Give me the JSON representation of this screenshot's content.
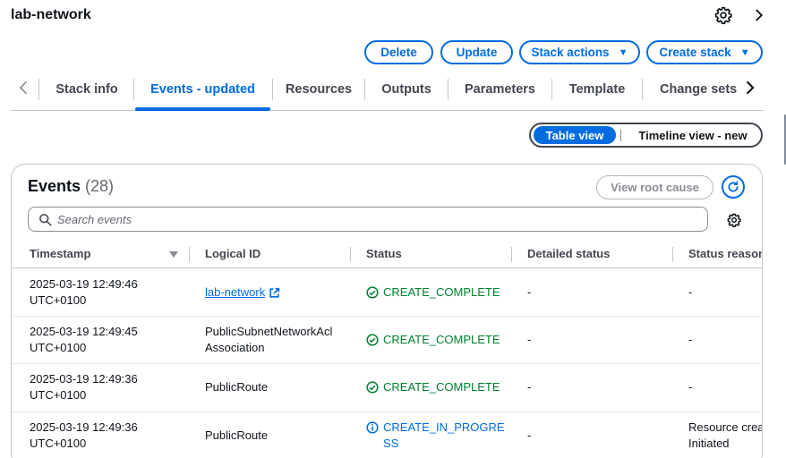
{
  "app": {
    "title": "lab-network",
    "settings_icon": "gear-icon",
    "expand_icon": "chevron-right-icon"
  },
  "actions": {
    "delete": "Delete",
    "update": "Update",
    "stack_actions": "Stack actions",
    "create_stack": "Create stack",
    "dropdown_icon": "caret-down-icon"
  },
  "tabs": [
    {
      "label": "Stack info"
    },
    {
      "label": "Events - updated",
      "active": true
    },
    {
      "label": "Resources"
    },
    {
      "label": "Outputs"
    },
    {
      "label": "Parameters"
    },
    {
      "label": "Template"
    },
    {
      "label": "Change sets"
    }
  ],
  "view_toggle": {
    "selected": "Table view",
    "other": "Timeline view - new"
  },
  "events": {
    "title": "Events",
    "count": "(28)",
    "view_root_cause": "View root cause",
    "search_placeholder": "Search events",
    "columns": [
      "Timestamp",
      "Logical ID",
      "Status",
      "Detailed status",
      "Status reason"
    ],
    "rows": [
      {
        "timestamp_line1": "2025-03-19 12:49:46",
        "timestamp_line2": "UTC+0100",
        "logical_id": "lab-network",
        "logical_id_is_link": true,
        "status": "CREATE_COMPLETE",
        "status_kind": "success",
        "detailed_status": "-",
        "status_reason": "-"
      },
      {
        "timestamp_line1": "2025-03-19 12:49:45",
        "timestamp_line2": "UTC+0100",
        "logical_id": "PublicSubnetNetworkAcl Association",
        "status": "CREATE_COMPLETE",
        "status_kind": "success",
        "detailed_status": "-",
        "status_reason": "-"
      },
      {
        "timestamp_line1": "2025-03-19 12:49:36",
        "timestamp_line2": "UTC+0100",
        "logical_id": "PublicRoute",
        "status": "CREATE_COMPLETE",
        "status_kind": "success",
        "detailed_status": "-",
        "status_reason": "-"
      },
      {
        "timestamp_line1": "2025-03-19 12:49:36",
        "timestamp_line2": "UTC+0100",
        "logical_id": "PublicRoute",
        "status": "CREATE_IN_PROGRESS",
        "status_kind": "info",
        "detailed_status": "-",
        "status_reason_line1": "Resource creat",
        "status_reason_line2": "Initiated"
      }
    ]
  },
  "colors": {
    "accent": "#006ce0",
    "success": "#00802f",
    "text": "#0f141a",
    "border": "#c6c6cd"
  }
}
